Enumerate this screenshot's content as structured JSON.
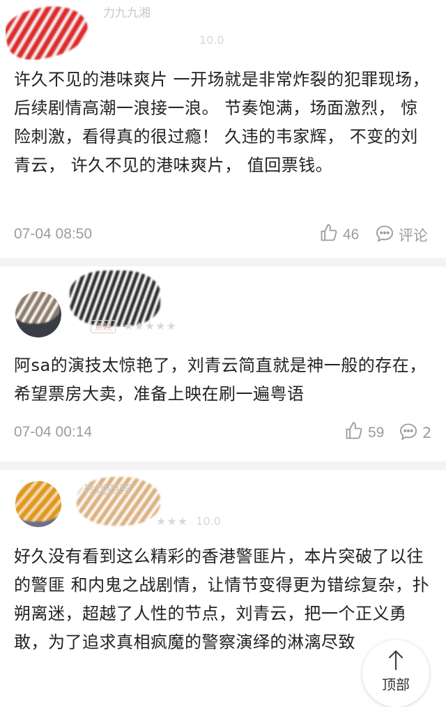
{
  "comments": [
    {
      "username": "力九九湘",
      "rating": "10.0",
      "badge": "",
      "stars": "",
      "text": "许久不见的港味爽片 一开场就是非常炸裂的犯罪现场， 后续剧情高潮一浪接一浪。 节奏饱满，场面激烈， 惊险刺激，看得真的很过瘾！ 久违的韦家辉， 不变的刘青云， 许久不见的港味爽片， 值回票钱。",
      "time": "07-04 08:50",
      "likes": "46",
      "reply_label": "评论"
    },
    {
      "username": "",
      "rating": "",
      "badge": "点映",
      "stars": "★★★★★",
      "text": "阿sa的演技太惊艳了，刘青云简直就是神一般的存在，希望票房大卖，准备上映在刷一遍粤语",
      "time": "07-04 00:14",
      "likes": "59",
      "reply_label": "2"
    },
    {
      "username": "玲珑四芳",
      "rating": "10.0",
      "badge": "",
      "stars": "★★★",
      "text": "好久没有看到这么精彩的香港警匪片，本片突破了以往的警匪 和内鬼之战剧情，让情节变得更为错综复杂，扑朔离迷，超越了人性的节点，刘青云，把一个正义勇敢，为了追求真相疯魔的警察演绎的淋漓尽致",
      "time": "",
      "likes": "",
      "reply_label": ""
    }
  ],
  "top_button": {
    "label": "顶部"
  },
  "colors": {
    "text": "#222222",
    "meta": "#9c9c9c",
    "divider": "#f3f3f3",
    "scribble_red": "#e02a2a",
    "scribble_dark": "#2a2a2a",
    "scribble_orange": "#e0961e"
  },
  "icons": [
    "thumbs-up-icon",
    "comment-bubble-icon",
    "arrow-up-icon"
  ]
}
